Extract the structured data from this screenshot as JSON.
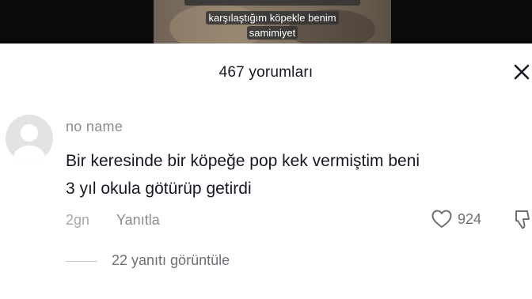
{
  "video": {
    "caption_lines": [
      "karşılaştığım köpekle benim",
      "samimiyet"
    ]
  },
  "comments_sheet": {
    "title": "467 yorumları",
    "close_icon": "close-icon"
  },
  "comment": {
    "username": "no name",
    "text_lines": [
      "Bir keresinde bir köpeğe pop kek vermiştim beni",
      "3 yıl okula götürüp getirdi"
    ],
    "time": "2gn",
    "reply_label": "Yanıtla",
    "like_count": "924",
    "view_replies_label": "22 yanıtı görüntüle",
    "icons": [
      "avatar-placeholder-icon",
      "heart-icon",
      "thumbs-down-icon"
    ]
  }
}
